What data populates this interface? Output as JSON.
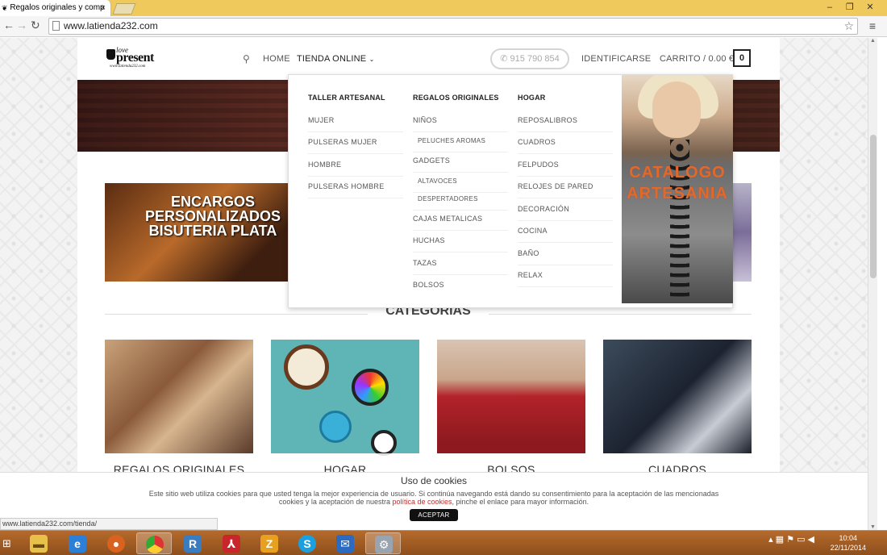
{
  "browser": {
    "tab_title": "Regalos originales y comp",
    "tab_close": "×",
    "url": "www.latienda232.com",
    "status_url": "www.latienda232.com/tienda/",
    "win_controls": [
      "–",
      "❐",
      "✕"
    ]
  },
  "header": {
    "logo_line1": "love",
    "logo_line2": "present",
    "logo_line3": "www.latienda232.com",
    "search_icon": "search-icon",
    "nav_home": "HOME",
    "nav_shop": "TIENDA ONLINE",
    "phone": "915 790 854",
    "login": "IDENTIFICARSE",
    "cart": "CARRITO / 0.00 €",
    "cart_count": "0"
  },
  "dropdown": {
    "col1": {
      "heading": "TALLER ARTESANAL",
      "items": [
        "MUJER",
        "PULSERAS MUJER",
        "HOMBRE",
        "PULSERAS HOMBRE"
      ]
    },
    "col2": {
      "heading": "REGALOS ORIGINALES",
      "items": [
        "NIÑOS",
        "PELUCHES AROMAS",
        "GADGETS",
        "ALTAVOCES",
        "DESPERTADORES",
        "CAJAS METALICAS",
        "HUCHAS",
        "TAZAS",
        "BOLSOS"
      ]
    },
    "col3": {
      "heading": "HOGAR",
      "items": [
        "REPOSALIBROS",
        "CUADROS",
        "FELPUDOS",
        "RELOJES DE PARED",
        "DECORACIÓN",
        "COCINA",
        "BAÑO",
        "RELAX"
      ]
    },
    "banner_text": "CATALOGO ARTESANIA"
  },
  "promo": {
    "text": "ENCARGOS PERSONALIZADOS BISUTERIA PLATA"
  },
  "categories": {
    "heading": "CATEGORIAS",
    "tiles": [
      "REGALOS ORIGINALES",
      "HOGAR",
      "BOLSOS",
      "CUADROS"
    ]
  },
  "cookies": {
    "title": "Uso de cookies",
    "text_before": "Este sitio web utiliza cookies para que usted tenga la mejor experiencia de usuario. Si continúa navegando está dando su consentimiento para la aceptación de las mencionadas cookies y la aceptación de nuestra ",
    "link": "política de cookies",
    "text_after": ", pinche el enlace para mayor información.",
    "button": "ACEPTAR"
  },
  "taskbar": {
    "time": "10:04",
    "date": "22/11/2014"
  },
  "colors": {
    "taskbar": "#9a5522",
    "tab_strip": "#f0c95c",
    "catalog_text": "#e06a2a",
    "cookie_link": "#b33333"
  }
}
